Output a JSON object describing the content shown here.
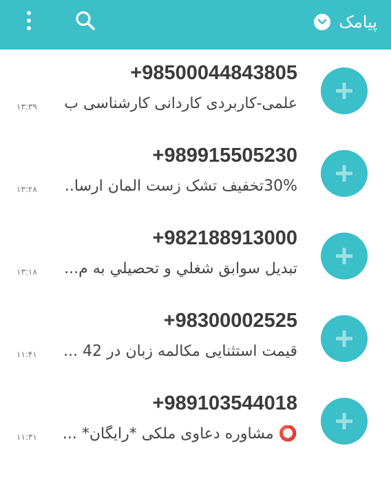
{
  "app": {
    "title": "پیامک",
    "accent_color": "#3bbfc8",
    "icons": {
      "menu": "more-vert-icon",
      "search": "search-icon",
      "dropdown": "chevron-down-icon",
      "avatar": "add-contact-icon"
    }
  },
  "messages": [
    {
      "sender": "+98500044843805",
      "preview": "علمی-کاربردی کاردانی کارشناسی ب...",
      "time": "۱۳:۳۹"
    },
    {
      "sender": "+989915505230",
      "preview": "30%تخفیف تشک زست المان ارسا...",
      "time": "۱۳:۲۸"
    },
    {
      "sender": "+982188913000",
      "preview": "تبديل سوابق شغلي و تحصيلي به م...",
      "time": "۱۳:۱۸"
    },
    {
      "sender": "+98300002525",
      "preview": "قیمت استثنایی مکالمه زبان در 42 ...",
      "time": "۱۱:۴۱"
    },
    {
      "sender": "+989103544018",
      "preview": "⭕ مشاوره دعاوی ملکی *رایگان* ...",
      "time": "۱۱:۳۱"
    }
  ]
}
